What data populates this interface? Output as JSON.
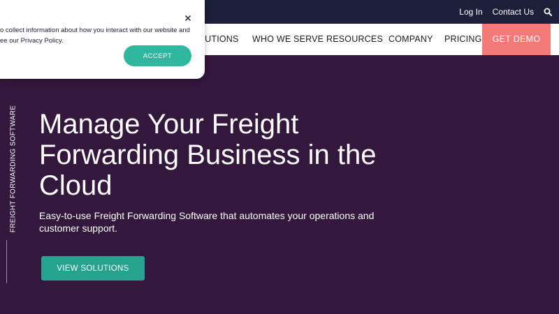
{
  "topbar": {
    "login": "Log In",
    "contact": "Contact Us",
    "search_icon": "search-icon"
  },
  "nav": {
    "items": [
      "LUTIONS",
      "WHO WE SERVE",
      "RESOURCES",
      "COMPANY",
      "PRICING"
    ],
    "demo": "GET DEMO"
  },
  "side_label": "FREIGHT FORWARDING SOFTWARE",
  "hero": {
    "title_lines": [
      "Manage Your Freight",
      "Forwarding Business in the",
      "Cloud"
    ],
    "subtitle": "Easy-to-use Freight Forwarding Software that automates your operations and customer support.",
    "button": "VIEW SOLUTIONS"
  },
  "cookie": {
    "line1": "o collect information about how you interact with our website and",
    "line2_prefix": "ee our ",
    "policy_link": "Privacy Policy",
    "line2_suffix": ".",
    "accept": "ACCEPT",
    "close_icon": "close-icon"
  },
  "colors": {
    "topbar": "#1b1f3a",
    "hero_bg": "#34173d",
    "demo": "#f47a78",
    "accent": "#26a38f",
    "accept": "#2fb7a0"
  }
}
